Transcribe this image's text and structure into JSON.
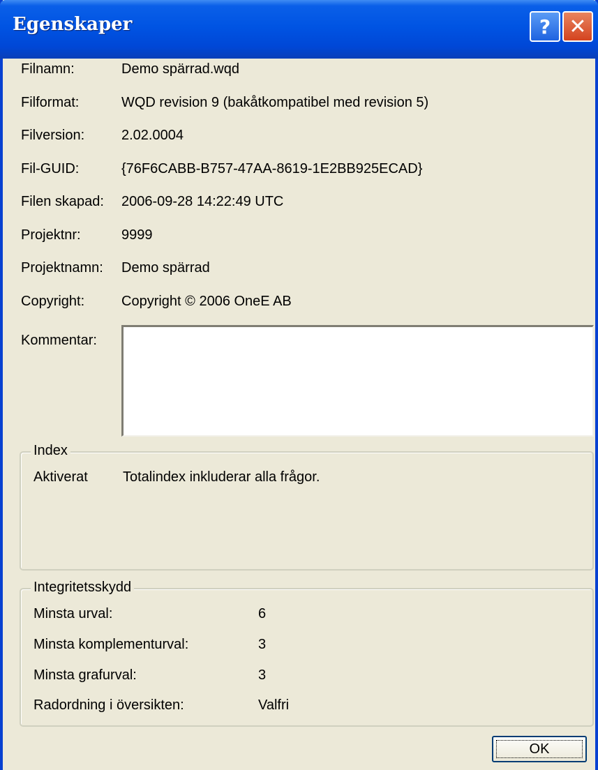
{
  "window": {
    "title": "Egenskaper",
    "help_glyph": "?",
    "close_glyph": "✕"
  },
  "properties": [
    {
      "label": "Filnamn:",
      "value": "Demo spärrad.wqd"
    },
    {
      "label": "Filformat:",
      "value": "WQD revision 9 (bakåtkompatibel med revision 5)"
    },
    {
      "label": "Filversion:",
      "value": "2.02.0004"
    },
    {
      "label": "Fil-GUID:",
      "value": "{76F6CABB-B757-47AA-8619-1E2BB925ECAD}"
    },
    {
      "label": "Filen skapad:",
      "value": "2006-09-28 14:22:49 UTC"
    },
    {
      "label": "Projektnr:",
      "value": "9999"
    },
    {
      "label": "Projektnamn:",
      "value": "Demo spärrad"
    },
    {
      "label": "Copyright:",
      "value": "Copyright © 2006 OneE AB"
    }
  ],
  "comment": {
    "label": "Kommentar:",
    "value": ""
  },
  "index": {
    "legend": "Index",
    "status": "Aktiverat",
    "description": "Totalindex inkluderar alla frågor."
  },
  "integrity": {
    "legend": "Integritetsskydd",
    "rows": [
      {
        "label": "Minsta urval:",
        "value": "6"
      },
      {
        "label": "Minsta komplementurval:",
        "value": "3"
      },
      {
        "label": "Minsta grafurval:",
        "value": "3"
      },
      {
        "label": "Radordning i översikten:",
        "value": "Valfri"
      }
    ]
  },
  "ok_label": "OK"
}
